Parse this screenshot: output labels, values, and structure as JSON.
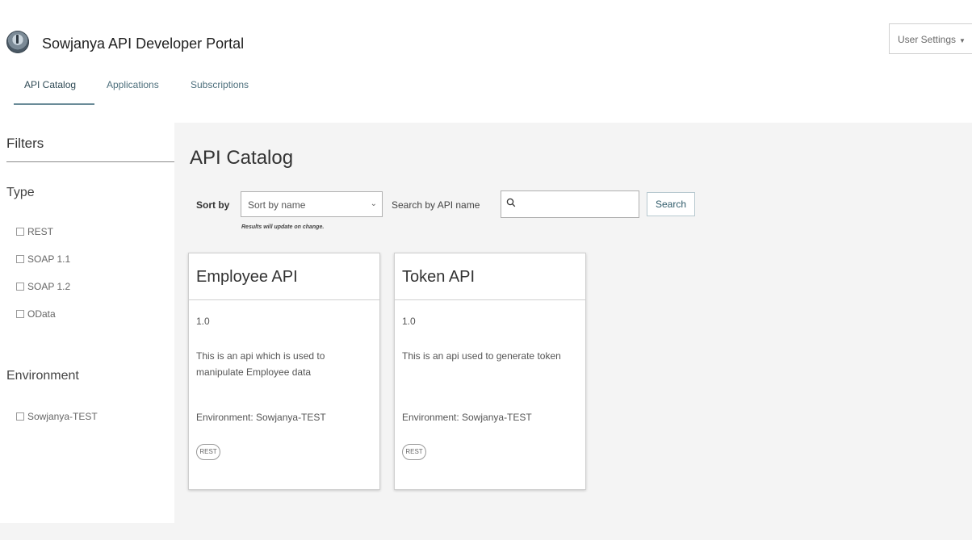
{
  "header": {
    "title": "Sowjanya API Developer Portal",
    "logo_icon": "portal-logo-icon",
    "user_settings_label": "User Settings"
  },
  "tabs": [
    {
      "label": "API Catalog",
      "active": true
    },
    {
      "label": "Applications",
      "active": false
    },
    {
      "label": "Subscriptions",
      "active": false
    }
  ],
  "sidebar": {
    "title": "Filters",
    "type_group": {
      "title": "Type",
      "items": [
        "REST",
        "SOAP 1.1",
        "SOAP 1.2",
        "OData"
      ]
    },
    "environment_group": {
      "title": "Environment",
      "items": [
        "Sowjanya-TEST"
      ]
    }
  },
  "main": {
    "title": "API Catalog",
    "sort": {
      "label": "Sort by",
      "selected": "Sort by name",
      "hint": "Results will update on change."
    },
    "search": {
      "label": "Search by API name",
      "value": "",
      "button_label": "Search"
    },
    "cards": [
      {
        "title": "Employee API",
        "version": "1.0",
        "description": "This is an api which is used to manipulate Employee data",
        "environment": "Environment: Sowjanya-TEST",
        "badge": "REST"
      },
      {
        "title": "Token API",
        "version": "1.0",
        "description": "This is an api used to generate token",
        "environment": "Environment: Sowjanya-TEST",
        "badge": "REST"
      }
    ]
  },
  "colors": {
    "accent": "#4d6f7c",
    "background": "#f4f4f4"
  }
}
